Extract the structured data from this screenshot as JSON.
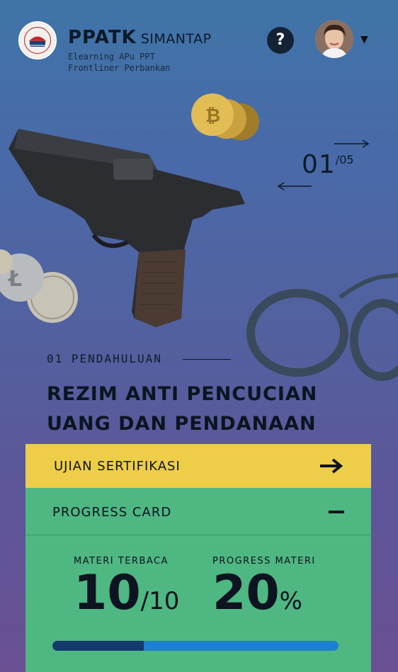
{
  "header": {
    "brand_title": "PPATK",
    "brand_sub": "SIMANTAP",
    "line1": "Elearning APu PPT",
    "line2": "Frontliner Perbankan",
    "help_label": "?",
    "caret": "▼"
  },
  "slider": {
    "current": "01",
    "total": "/05"
  },
  "section": {
    "label": "01  PENDAHULUAN",
    "headline": "REZIM ANTI PENCUCIAN UANG DAN PENDANAAN TERORISME DI INDONESIA"
  },
  "exam": {
    "label": "UJIAN SERTIFIKASI",
    "arrow_icon": "arrow-right-icon"
  },
  "progress_card": {
    "title": "PROGRESS CARD",
    "collapse_icon": "minus-icon",
    "materi_terbaca_label": "MATERI TERBACA",
    "materi_terbaca_value": "10",
    "materi_terbaca_total": "/10",
    "progress_label": "PROGRESS MATERI",
    "progress_value": "20",
    "progress_suffix": "%",
    "progress_fraction": 0.32
  },
  "colors": {
    "exam_bar": "#eecd48",
    "progress_card": "#4fb782",
    "bar_track": "#1d7fd0",
    "bar_fill": "#123a6b"
  }
}
